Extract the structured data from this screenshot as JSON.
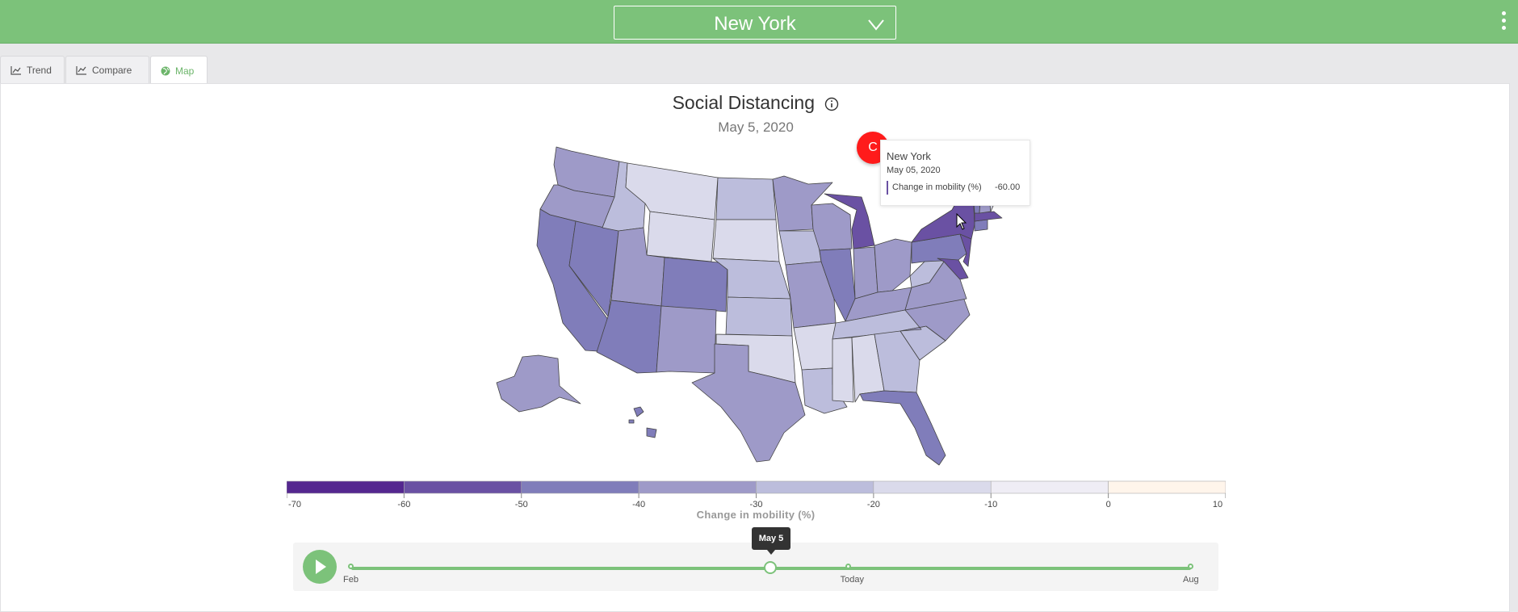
{
  "header": {
    "location": "New York",
    "location_icon": "chevron-down-icon",
    "menu_icon": "kebab-menu-icon",
    "bg_color": "#7cc27a"
  },
  "tabs": [
    {
      "label": "Trend",
      "icon": "line-chart-icon",
      "active": false
    },
    {
      "label": "Compare",
      "icon": "compare-chart-icon",
      "active": false
    },
    {
      "label": "Map",
      "icon": "globe-icon",
      "active": true
    }
  ],
  "map": {
    "title": "Social Distancing",
    "title_icon": "info-icon",
    "date": "May 5, 2020"
  },
  "tooltip": {
    "region": "New York",
    "date": "May 05, 2020",
    "metric": "Change in mobility (%)",
    "value": "-60.00",
    "swatch_color": "#6a51a3"
  },
  "marker": {
    "label": "C"
  },
  "legend": {
    "title": "Change in mobility (%)",
    "ticks": [
      "-70",
      "-60",
      "-50",
      "-40",
      "-30",
      "-20",
      "-10",
      "0",
      "10"
    ],
    "colors": [
      "#54278f",
      "#6a51a3",
      "#807dba",
      "#9e9ac8",
      "#bcbddc",
      "#dadaeb",
      "#efedf5",
      "#fff5eb"
    ]
  },
  "timeline": {
    "play_icon": "play-icon",
    "current": "May 5",
    "current_fraction": 0.5,
    "labels": [
      {
        "text": "Feb",
        "fraction": 0.0
      },
      {
        "text": "Today",
        "fraction": 0.592
      },
      {
        "text": "Aug",
        "fraction": 1.0
      }
    ]
  }
}
